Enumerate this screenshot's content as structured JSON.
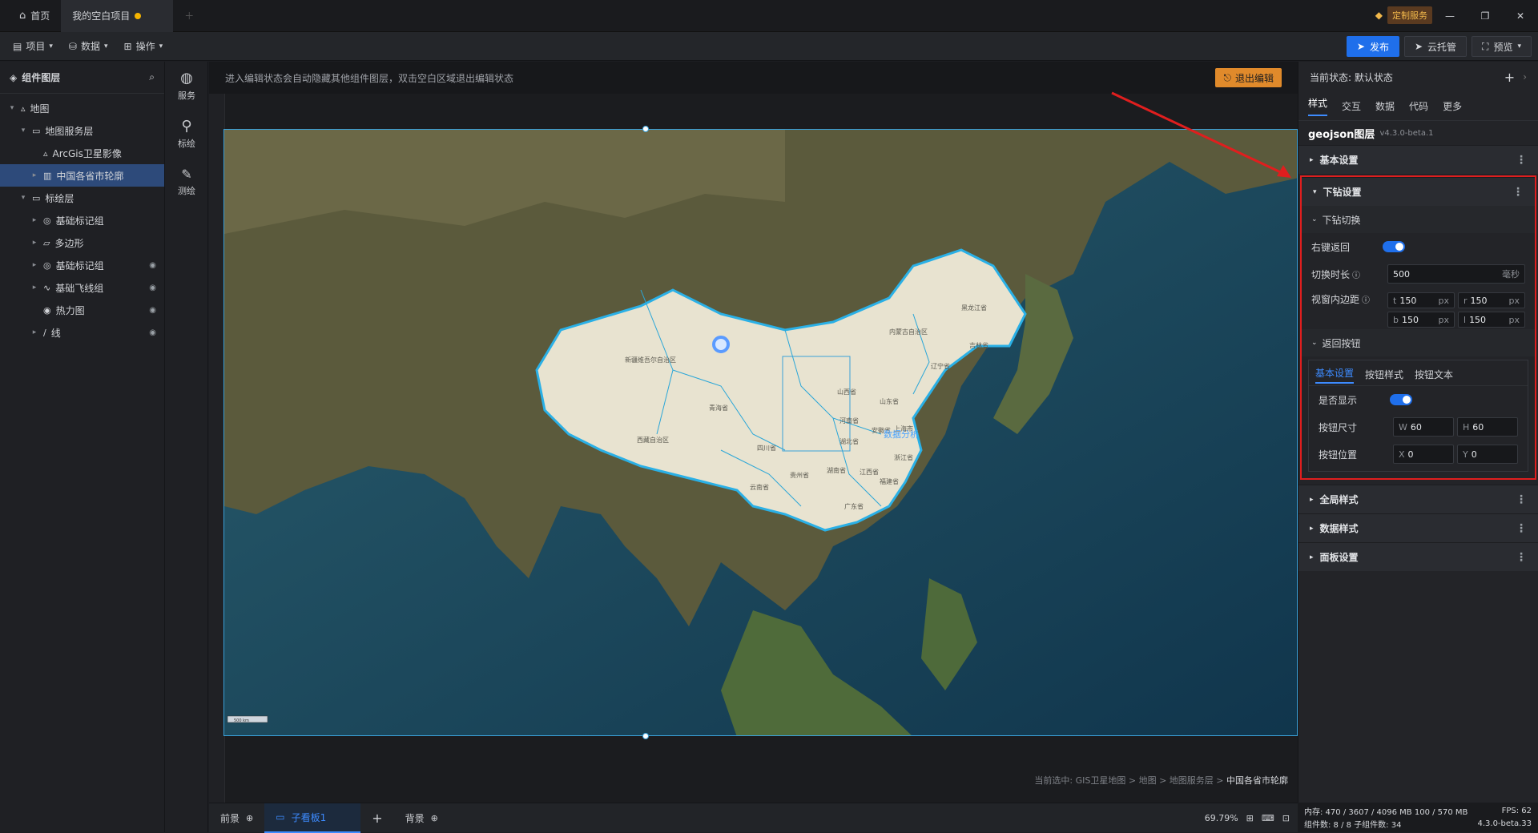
{
  "tabs": {
    "home": "首页",
    "project": "我的空白项目"
  },
  "topright": {
    "custom_service": "定制服务"
  },
  "menu": {
    "project": "项目",
    "data": "数据",
    "operate": "操作"
  },
  "toolbar": {
    "publish": "发布",
    "cloud": "云托管",
    "preview": "预览"
  },
  "layers": {
    "title": "组件图层",
    "tree": [
      {
        "label": "地图",
        "level": 0,
        "caret": "▾",
        "icon": "▵",
        "sel": false,
        "eye": false
      },
      {
        "label": "地图服务层",
        "level": 1,
        "caret": "▾",
        "icon": "▭",
        "sel": false,
        "eye": false
      },
      {
        "label": "ArcGis卫星影像",
        "level": 2,
        "caret": "",
        "icon": "▵",
        "sel": false,
        "eye": false
      },
      {
        "label": "中国各省市轮廓",
        "level": 2,
        "caret": "▸",
        "icon": "▥",
        "sel": true,
        "eye": false
      },
      {
        "label": "标绘层",
        "level": 1,
        "caret": "▾",
        "icon": "▭",
        "sel": false,
        "eye": false
      },
      {
        "label": "基础标记组",
        "level": 2,
        "caret": "▸",
        "icon": "◎",
        "sel": false,
        "eye": false
      },
      {
        "label": "多边形",
        "level": 2,
        "caret": "▸",
        "icon": "▱",
        "sel": false,
        "eye": false
      },
      {
        "label": "基础标记组",
        "level": 2,
        "caret": "▸",
        "icon": "◎",
        "sel": false,
        "eye": true
      },
      {
        "label": "基础飞线组",
        "level": 2,
        "caret": "▸",
        "icon": "∿",
        "sel": false,
        "eye": true
      },
      {
        "label": "热力图",
        "level": 2,
        "caret": "",
        "icon": "◉",
        "sel": false,
        "eye": true
      },
      {
        "label": "线",
        "level": 2,
        "caret": "▸",
        "icon": "∕",
        "sel": false,
        "eye": true
      }
    ]
  },
  "iconbar": {
    "service": "服务",
    "mark": "标绘",
    "measure": "测绘"
  },
  "canvas": {
    "banner": "进入编辑状态会自动隐藏其他组件图层，双击空白区域退出编辑状态",
    "exit_edit": "退出编辑",
    "breadcrumb_prefix": "当前选中: GIS卫星地图 > 地图 > 地图服务层 > ",
    "breadcrumb_current": "中国各省市轮廓",
    "scale": "500 km",
    "labels": {
      "heilongjiang": "黑龙江省",
      "jilin": "吉林省",
      "neimenggu": "内蒙古自治区",
      "liaoning": "辽宁省",
      "xinjiang": "新疆维吾尔自治区",
      "qinghai": "青海省",
      "xizang": "西藏自治区",
      "sichuan": "四川省",
      "shanxi": "山西省",
      "shandong": "山东省",
      "henan": "河南省",
      "hubei": "湖北省",
      "hunan": "湖南省",
      "jiangxi": "江西省",
      "guizhou": "贵州省",
      "yunnan": "云南省",
      "guangdong": "广东省",
      "fujian": "福建省",
      "zhejiang": "浙江省",
      "shanghai": "上海市",
      "anhui": "安徽省",
      "dashuju": "数据分析"
    }
  },
  "bottom": {
    "front": "前景",
    "panel": "子看板1",
    "back": "背景",
    "zoom": "69.79%"
  },
  "status": {
    "mem": "内存: 470 / 3607 / 4096 MB",
    "gpu": "100 / 570 MB",
    "fps": "FPS: 62",
    "components": "组件数: 8 / 8",
    "subcomponents": "子组件数: 34",
    "version": "4.3.0-beta.33"
  },
  "right": {
    "state_label": "当前状态: 默认状态",
    "tabs": [
      "样式",
      "交互",
      "数据",
      "代码",
      "更多"
    ],
    "layer_name": "geojson图层",
    "layer_version": "v4.3.0-beta.1",
    "basic": "基本设置",
    "drill": "下钻设置",
    "drill_switch": "下钻切换",
    "right_back": "右键返回",
    "switch_duration": "切换时长",
    "duration_value": "500",
    "duration_unit": "毫秒",
    "viewport_padding": "视窗内边距",
    "pad": {
      "t": "150",
      "r": "150",
      "b": "150",
      "l": "150",
      "unit": "px"
    },
    "back_button": "返回按钮",
    "back_tabs": [
      "基本设置",
      "按钮样式",
      "按钮文本"
    ],
    "show": "是否显示",
    "size": "按钮尺寸",
    "w": "60",
    "h": "60",
    "pos": "按钮位置",
    "x": "0",
    "y": "0",
    "global_style": "全局样式",
    "data_style": "数据样式",
    "panel_settings": "面板设置"
  }
}
